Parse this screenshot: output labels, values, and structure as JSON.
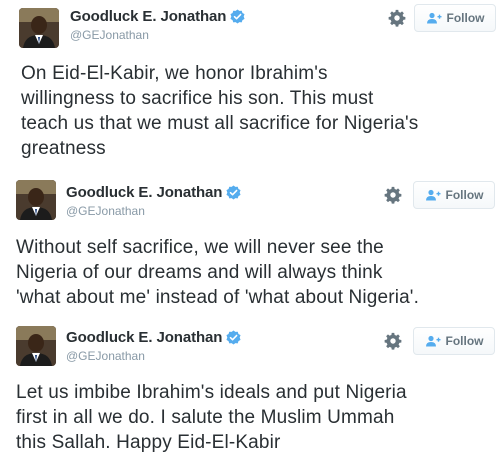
{
  "tweets": [
    {
      "author": {
        "name": "Goodluck E. Jonathan",
        "handle": "@GEJonathan"
      },
      "follow_label": "Follow",
      "text_lines": [
        "On Eid-El-Kabir, we honor Ibrahim's",
        "willingness to sacrifice his son. This must",
        "teach us that we must all sacrifice for Nigeria's",
        "greatness"
      ]
    },
    {
      "author": {
        "name": "Goodluck E. Jonathan",
        "handle": "@GEJonathan"
      },
      "follow_label": "Follow",
      "text_lines": [
        "Without self sacrifice, we will never see the",
        "Nigeria of our dreams and will always think",
        "'what about me' instead of 'what about Nigeria'."
      ]
    },
    {
      "author": {
        "name": "Goodluck E. Jonathan",
        "handle": "@GEJonathan"
      },
      "follow_label": "Follow",
      "text_lines": [
        "Let us imbibe Ibrahim's ideals and put Nigeria",
        "first in all we do. I salute the Muslim Ummah",
        "this Sallah. Happy Eid-El-Kabir"
      ]
    }
  ],
  "colors": {
    "verified_blue": "#55acee",
    "text": "#292f33",
    "muted": "#8899a6",
    "button_text": "#66757f"
  },
  "icons": {
    "verified": "verified-badge-icon",
    "gear": "gear-icon",
    "follow": "follow-person-plus-icon"
  }
}
